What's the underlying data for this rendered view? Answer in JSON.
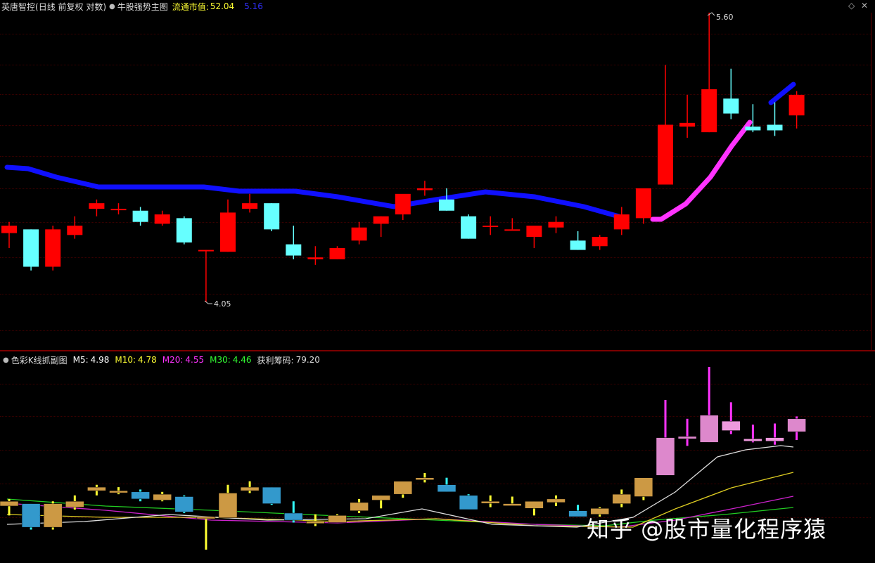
{
  "main_header": {
    "stock_name": "英唐智控",
    "period_info": "(日线 前复权 对数)",
    "indicator": "牛股强势主图",
    "float_cap_label": "流通市值:",
    "float_cap_value": "52.04",
    "blue_value": "5.16"
  },
  "sub_header": {
    "indicator": "色彩K线抓副图",
    "ma5_label": "M5:",
    "ma5_value": "4.98",
    "ma10_label": "M10:",
    "ma10_value": "4.78",
    "ma20_label": "M20:",
    "ma20_value": "4.55",
    "ma30_label": "M30:",
    "ma30_value": "4.46",
    "profit_label": "获利筹码:",
    "profit_value": "79.20"
  },
  "annotations": {
    "high": "5.60",
    "low": "4.05"
  },
  "watermark": "知乎 @股市量化程序猿",
  "colors": {
    "up": "#ff0000",
    "down": "#66ffff",
    "trend_blue": "#1010ff",
    "trend_magenta": "#ff33ff",
    "ma5": "#ffffff",
    "ma10": "#ffff00",
    "ma20": "#ff00ff",
    "ma30": "#00ff00"
  },
  "icons": [
    "circle-dropdown-icon",
    "diamond-icon",
    "close-icon"
  ],
  "chart_data": {
    "type": "candlestick",
    "candles": [
      {
        "o": 4.42,
        "h": 4.48,
        "l": 4.34,
        "c": 4.46
      },
      {
        "o": 4.44,
        "h": 4.44,
        "l": 4.22,
        "c": 4.24
      },
      {
        "o": 4.24,
        "h": 4.46,
        "l": 4.22,
        "c": 4.44
      },
      {
        "o": 4.41,
        "h": 4.51,
        "l": 4.39,
        "c": 4.46
      },
      {
        "o": 4.55,
        "h": 4.6,
        "l": 4.51,
        "c": 4.58
      },
      {
        "o": 4.55,
        "h": 4.58,
        "l": 4.52,
        "c": 4.55
      },
      {
        "o": 4.54,
        "h": 4.56,
        "l": 4.46,
        "c": 4.48
      },
      {
        "o": 4.47,
        "h": 4.54,
        "l": 4.46,
        "c": 4.52
      },
      {
        "o": 4.5,
        "h": 4.51,
        "l": 4.36,
        "c": 4.37
      },
      {
        "o": 4.33,
        "h": 4.33,
        "l": 4.05,
        "c": 4.33
      },
      {
        "o": 4.32,
        "h": 4.6,
        "l": 4.32,
        "c": 4.53
      },
      {
        "o": 4.55,
        "h": 4.63,
        "l": 4.53,
        "c": 4.58
      },
      {
        "o": 4.58,
        "h": 4.58,
        "l": 4.43,
        "c": 4.44
      },
      {
        "o": 4.36,
        "h": 4.46,
        "l": 4.28,
        "c": 4.3
      },
      {
        "o": 4.28,
        "h": 4.35,
        "l": 4.25,
        "c": 4.29
      },
      {
        "o": 4.28,
        "h": 4.35,
        "l": 4.28,
        "c": 4.34
      },
      {
        "o": 4.38,
        "h": 4.48,
        "l": 4.36,
        "c": 4.45
      },
      {
        "o": 4.47,
        "h": 4.51,
        "l": 4.4,
        "c": 4.51
      },
      {
        "o": 4.52,
        "h": 4.62,
        "l": 4.49,
        "c": 4.63
      },
      {
        "o": 4.65,
        "h": 4.7,
        "l": 4.62,
        "c": 4.66
      },
      {
        "o": 4.6,
        "h": 4.66,
        "l": 4.54,
        "c": 4.54
      },
      {
        "o": 4.51,
        "h": 4.52,
        "l": 4.39,
        "c": 4.39
      },
      {
        "o": 4.46,
        "h": 4.51,
        "l": 4.41,
        "c": 4.46
      },
      {
        "o": 4.44,
        "h": 4.5,
        "l": 4.44,
        "c": 4.44
      },
      {
        "o": 4.4,
        "h": 4.46,
        "l": 4.34,
        "c": 4.46
      },
      {
        "o": 4.45,
        "h": 4.51,
        "l": 4.42,
        "c": 4.48
      },
      {
        "o": 4.38,
        "h": 4.43,
        "l": 4.33,
        "c": 4.33
      },
      {
        "o": 4.35,
        "h": 4.41,
        "l": 4.33,
        "c": 4.4
      },
      {
        "o": 4.44,
        "h": 4.56,
        "l": 4.41,
        "c": 4.52
      },
      {
        "o": 4.5,
        "h": 4.65,
        "l": 4.47,
        "c": 4.66
      },
      {
        "o": 4.68,
        "h": 5.32,
        "l": 4.68,
        "c": 5.0
      },
      {
        "o": 4.99,
        "h": 5.16,
        "l": 4.93,
        "c": 5.01
      },
      {
        "o": 4.96,
        "h": 5.6,
        "l": 4.96,
        "c": 5.19
      },
      {
        "o": 5.14,
        "h": 5.3,
        "l": 5.03,
        "c": 5.06
      },
      {
        "o": 4.99,
        "h": 5.11,
        "l": 4.96,
        "c": 4.97
      },
      {
        "o": 5.0,
        "h": 5.12,
        "l": 4.94,
        "c": 4.97
      },
      {
        "o": 5.05,
        "h": 5.18,
        "l": 4.98,
        "c": 5.16
      }
    ]
  }
}
